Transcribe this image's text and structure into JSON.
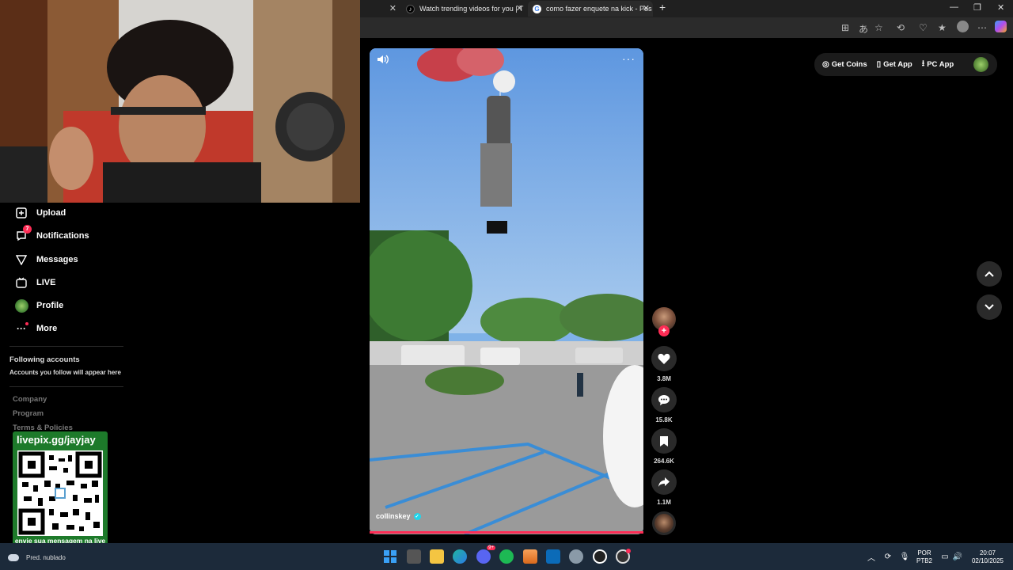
{
  "browser": {
    "tabs": [
      {
        "label": "Watch trending videos for you | T",
        "active": false
      },
      {
        "label": "como fazer enquete na kick - Pes",
        "active": true
      }
    ],
    "new_tab": "+",
    "window_controls": [
      "—",
      "❐",
      "✕"
    ]
  },
  "sidebar": {
    "nav": [
      {
        "label": "Upload",
        "icon": "upload-icon"
      },
      {
        "label": "Notifications",
        "icon": "bell-icon",
        "badge": "7"
      },
      {
        "label": "Messages",
        "icon": "send-icon"
      },
      {
        "label": "LIVE",
        "icon": "live-icon"
      },
      {
        "label": "Profile",
        "icon": "avatar"
      },
      {
        "label": "More",
        "icon": "more-icon"
      }
    ],
    "following_title": "Following accounts",
    "following_sub": "Accounts you follow will appear here",
    "footer": [
      "Company",
      "Program",
      "Terms & Policies"
    ]
  },
  "overlay": {
    "qr_title": "livepix.gg/jayjay",
    "qr_caption": "envie sua mensagem na live via pix!",
    "weather": "Pred. nublado"
  },
  "video": {
    "author": "collinskey",
    "likes": "3.8M",
    "comments": "15.8K",
    "saves": "264.6K",
    "shares": "1.1M"
  },
  "topbar": {
    "get_coins": "Get Coins",
    "get_app": "Get App",
    "pc_app": "PC App"
  },
  "taskbar": {
    "lang": "POR",
    "layout": "PTB2",
    "time": "20:07",
    "date": "02/10/2025",
    "discord_badge": "9+"
  },
  "colors": {
    "accent": "#fe2c55",
    "verified": "#20d5ec",
    "qr_bg": "#1d7a2a",
    "taskbar": "#1c2a3a"
  }
}
